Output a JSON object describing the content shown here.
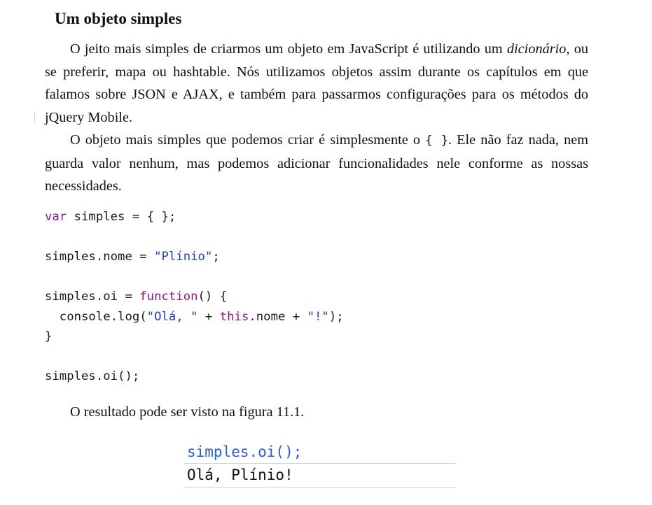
{
  "heading": "Um objeto simples",
  "paragraph1": {
    "before_italic": "O jeito mais simples de criarmos um objeto em JavaScript é utilizando um ",
    "italic": "dicionário",
    "after_italic": ", ou se preferir, mapa ou hashtable.  Nós utilizamos objetos assim durante os capítulos em que falamos sobre JSON e AJAX, e também para passarmos configurações para os métodos do jQuery Mobile."
  },
  "paragraph2": {
    "before_code": "O objeto mais simples que podemos criar é simplesmente o ",
    "code": "{ }",
    "after_code": ". Ele não faz nada, nem guarda valor nenhum, mas podemos adicionar funcionalidades nele conforme as nossas necessidades."
  },
  "code_lines": [
    [
      {
        "t": "var",
        "c": "kw"
      },
      {
        "t": " simples = { };",
        "c": ""
      }
    ],
    [],
    [
      {
        "t": "simples.nome = ",
        "c": ""
      },
      {
        "t": "\"Plínio\"",
        "c": "str"
      },
      {
        "t": ";",
        "c": ""
      }
    ],
    [],
    [
      {
        "t": "simples.oi = ",
        "c": ""
      },
      {
        "t": "function",
        "c": "kw"
      },
      {
        "t": "() {",
        "c": ""
      }
    ],
    [
      {
        "t": "  console.log(",
        "c": ""
      },
      {
        "t": "\"Olá, \"",
        "c": "str"
      },
      {
        "t": " + ",
        "c": ""
      },
      {
        "t": "this",
        "c": "kw"
      },
      {
        "t": ".nome + ",
        "c": ""
      },
      {
        "t": "\"!\"",
        "c": "str"
      },
      {
        "t": ");",
        "c": ""
      }
    ],
    [
      {
        "t": "}",
        "c": ""
      }
    ],
    [],
    [
      {
        "t": "simples.oi();",
        "c": ""
      }
    ]
  ],
  "paragraph3": "O resultado pode ser visto na figura 11.1.",
  "figure": {
    "input_line": "simples.oi();",
    "output_line": "Olá, Plínio!"
  },
  "colors": {
    "keyword": "#8a1a8a",
    "string": "#1f3fb0",
    "console_input": "#2a5fcc"
  }
}
